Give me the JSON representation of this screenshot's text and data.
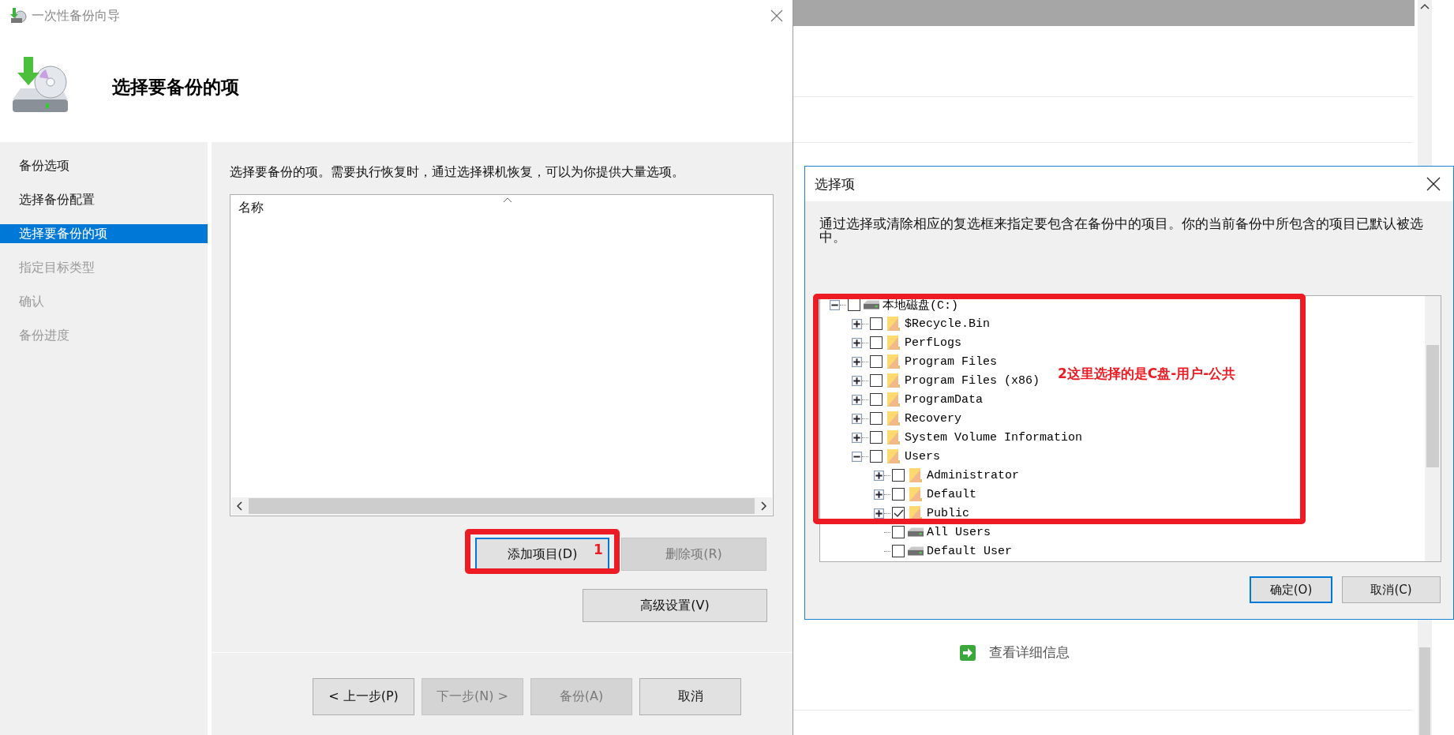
{
  "wizard": {
    "title": "一次性备份向导",
    "heading": "选择要备份的项",
    "steps": [
      {
        "label": "备份选项",
        "selected": false,
        "completed": true
      },
      {
        "label": "选择备份配置",
        "selected": false,
        "completed": true
      },
      {
        "label": "选择要备份的项",
        "selected": true,
        "completed": false
      },
      {
        "label": "指定目标类型",
        "selected": false,
        "completed": false
      },
      {
        "label": "确认",
        "selected": false,
        "completed": false
      },
      {
        "label": "备份进度",
        "selected": false,
        "completed": false
      }
    ],
    "instruction": "选择要备份的项。需要执行恢复时，通过选择裸机恢复，可以为你提供大量选项。",
    "list": {
      "columns": [
        {
          "label": "名称",
          "sorted": true
        }
      ]
    },
    "item_buttons": [
      {
        "label": "添加项目(D)",
        "disabled": false,
        "focused": true
      },
      {
        "label": "删除项(R)",
        "disabled": true,
        "focused": false
      }
    ],
    "advanced_button": {
      "label": "高级设置(V)",
      "disabled": false,
      "focused": false
    },
    "footer_buttons": [
      {
        "label": "< 上一步(P)",
        "disabled": false,
        "focused": false
      },
      {
        "label": "下一步(N) >",
        "disabled": true,
        "focused": false
      },
      {
        "label": "备份(A)",
        "disabled": true,
        "focused": false
      },
      {
        "label": "取消",
        "disabled": false,
        "focused": false
      }
    ]
  },
  "background_window": {
    "link": "查看详细信息"
  },
  "dialog": {
    "title": "选择项",
    "description": "通过选择或清除相应的复选框来指定要包含在备份中的项目。你的当前备份中所包含的项目已默认被选中。",
    "tree": [
      {
        "label": "本地磁盘(C:)",
        "kind": "drive",
        "expandable": true,
        "expanded": true,
        "checked": false,
        "children": [
          {
            "label": "$Recycle.Bin",
            "kind": "folder",
            "expandable": true,
            "expanded": false,
            "checked": false
          },
          {
            "label": "PerfLogs",
            "kind": "folder",
            "expandable": true,
            "expanded": false,
            "checked": false
          },
          {
            "label": "Program Files",
            "kind": "folder",
            "expandable": true,
            "expanded": false,
            "checked": false
          },
          {
            "label": "Program Files (x86)",
            "kind": "folder",
            "expandable": true,
            "expanded": false,
            "checked": false
          },
          {
            "label": "ProgramData",
            "kind": "folder",
            "expandable": true,
            "expanded": false,
            "checked": false
          },
          {
            "label": "Recovery",
            "kind": "folder",
            "expandable": true,
            "expanded": false,
            "checked": false
          },
          {
            "label": "System Volume Information",
            "kind": "folder",
            "expandable": true,
            "expanded": false,
            "checked": false
          },
          {
            "label": "Users",
            "kind": "folder",
            "expandable": true,
            "expanded": true,
            "checked": false,
            "children": [
              {
                "label": "Administrator",
                "kind": "folder",
                "expandable": true,
                "expanded": false,
                "checked": false
              },
              {
                "label": "Default",
                "kind": "folder",
                "expandable": true,
                "expanded": false,
                "checked": false
              },
              {
                "label": "Public",
                "kind": "folder",
                "expandable": true,
                "expanded": false,
                "checked": true
              },
              {
                "label": "All Users",
                "kind": "drive",
                "checked": false
              },
              {
                "label": "Default User",
                "kind": "drive",
                "checked": false
              }
            ]
          }
        ]
      }
    ],
    "buttons": [
      {
        "label": "确定(O)",
        "focused": true
      },
      {
        "label": "取消(C)",
        "focused": false
      }
    ]
  },
  "annotations": [
    {
      "text": "1"
    },
    {
      "text": "2这里选择的是C盘-用户-公共"
    }
  ]
}
